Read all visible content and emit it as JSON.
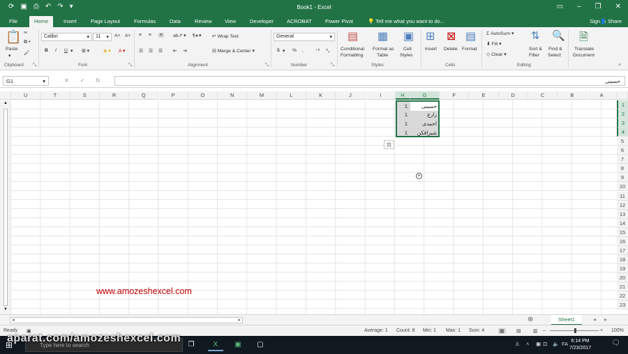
{
  "window": {
    "title": "Book1 - Excel"
  },
  "tabs": [
    "File",
    "Home",
    "Insert",
    "Page Layout",
    "Formulas",
    "Data",
    "Review",
    "View",
    "Developer",
    "ACROBAT",
    "Power Pivot"
  ],
  "tell_me": "Tell me what you want to do...",
  "sign_in": "Sign in",
  "share": "Share",
  "ribbon": {
    "clipboard": {
      "paste": "Paste",
      "label": "Clipboard"
    },
    "font": {
      "name": "Calibri",
      "size": "11",
      "label": "Font",
      "bold": "B",
      "italic": "I",
      "underline": "U"
    },
    "alignment": {
      "wrap": "Wrap Text",
      "merge": "Merge & Center",
      "label": "Alignment"
    },
    "number": {
      "format": "General",
      "label": "Number",
      "currency": "$",
      "percent": "%",
      "comma": ","
    },
    "styles": {
      "conditional": "Conditional",
      "conditional2": "Formatting",
      "format_table": "Format as",
      "format_table2": "Table",
      "cell_styles": "Cell",
      "cell_styles2": "Styles",
      "label": "Styles"
    },
    "cells": {
      "insert": "Insert",
      "delete": "Delete",
      "format": "Format",
      "label": "Cells"
    },
    "editing": {
      "autosum": "AutoSum",
      "fill": "Fill",
      "clear": "Clear",
      "sort": "Sort &",
      "sort2": "Filter",
      "find": "Find &",
      "find2": "Select",
      "label": "Editing"
    },
    "translate": {
      "line1": "Translate",
      "line2": "Document"
    }
  },
  "formula_bar": {
    "name_box": "G1",
    "fx": "fx",
    "content": "حسینی"
  },
  "columns": [
    "U",
    "T",
    "S",
    "R",
    "Q",
    "P",
    "O",
    "N",
    "M",
    "L",
    "K",
    "J",
    "I",
    "H",
    "G",
    "F",
    "E",
    "D",
    "C",
    "B",
    "A"
  ],
  "rows": [
    "1",
    "2",
    "3",
    "4",
    "5",
    "6",
    "7",
    "8",
    "9",
    "10",
    "11",
    "12",
    "13",
    "14",
    "15",
    "16",
    "17",
    "18",
    "19",
    "20",
    "21",
    "22",
    "23"
  ],
  "cells": {
    "H": [
      "1",
      "1",
      "1",
      "1"
    ],
    "G": [
      "حسینی",
      "زارع",
      "احمدی",
      "شیرافکن"
    ]
  },
  "website": "www.amozeshexcel.com",
  "sheet_tab": "Sheet1",
  "status": {
    "ready": "Ready",
    "average": "Average: 1",
    "count": "Count: 8",
    "min": "Min: 1",
    "max": "Max: 1",
    "sum": "Sum: 4",
    "zoom": "100%"
  },
  "taskbar": {
    "search_placeholder": "Type here to search",
    "lang": "FA",
    "time": "6:14 PM",
    "date": "7/23/2017"
  },
  "watermark": "aparat.com/amozeshexcel.com"
}
